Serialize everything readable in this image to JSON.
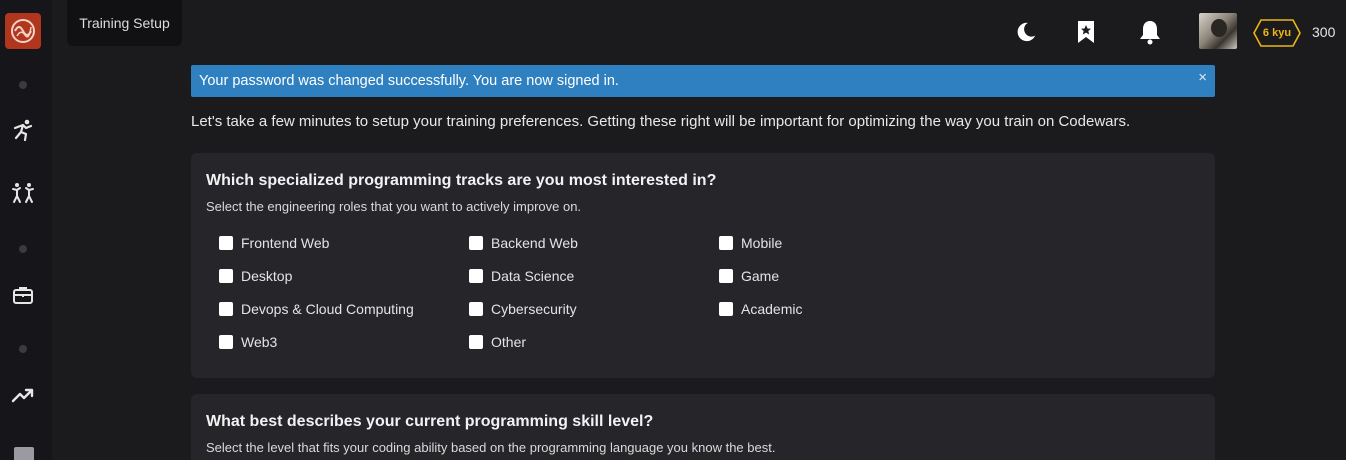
{
  "tooltip": {
    "text": "Training Setup"
  },
  "header": {
    "rank": "6 kyu",
    "honor": "300",
    "rank_color": "#ecb613"
  },
  "alert": {
    "message": "Your password was changed successfully. You are now signed in.",
    "close": "×",
    "color": "#2f80c0"
  },
  "intro": "Let's take a few minutes to setup your training preferences. Getting these right will be important for optimizing the way you train on Codewars.",
  "tracks": {
    "title": "Which specialized programming tracks are you most interested in?",
    "subtitle": "Select the engineering roles that you want to actively improve on.",
    "options": [
      "Frontend Web",
      "Backend Web",
      "Mobile",
      "Desktop",
      "Data Science",
      "Game",
      "Devops & Cloud Computing",
      "Cybersecurity",
      "Academic",
      "Web3",
      "Other"
    ]
  },
  "skill": {
    "title": "What best describes your current programming skill level?",
    "subtitle": "Select the level that fits your coding ability based on the programming language you know the best."
  },
  "icons": {
    "logo": "codewars-logo-icon",
    "sidebar": [
      "training-icon",
      "practice-icon",
      "briefcase-icon",
      "trending-icon"
    ],
    "topbar": [
      "moon-icon",
      "bookmark-star-icon",
      "bell-icon"
    ]
  }
}
